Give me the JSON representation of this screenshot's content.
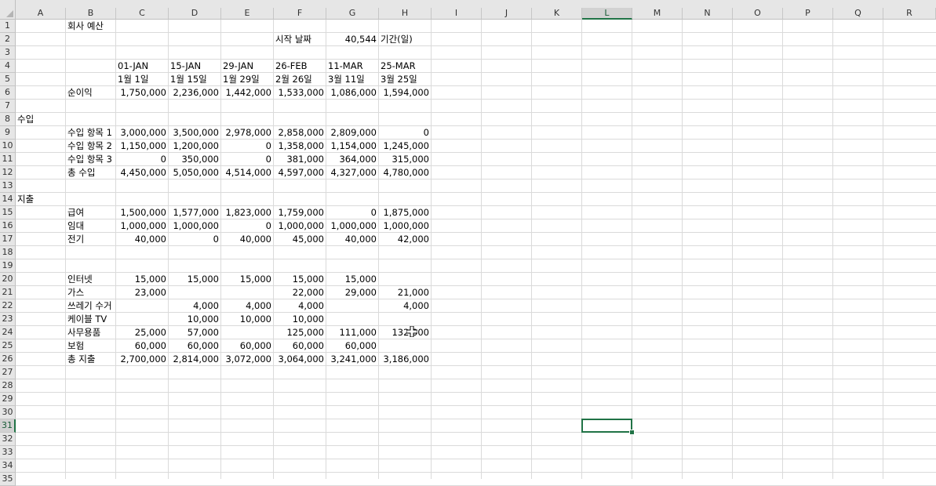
{
  "columns": [
    "A",
    "B",
    "C",
    "D",
    "E",
    "F",
    "G",
    "H",
    "I",
    "J",
    "K",
    "L",
    "M",
    "N",
    "O",
    "P",
    "Q",
    "R"
  ],
  "rows": [
    "1",
    "2",
    "3",
    "4",
    "5",
    "6",
    "7",
    "8",
    "9",
    "10",
    "11",
    "12",
    "13",
    "14",
    "15",
    "16",
    "17",
    "18",
    "19",
    "20",
    "21",
    "22",
    "23",
    "24",
    "25",
    "26",
    "27",
    "28",
    "29",
    "30",
    "31",
    "32",
    "33",
    "34",
    "35"
  ],
  "selected_column": "L",
  "selected_row": "31",
  "cells": [
    {
      "col": "B",
      "row": "1",
      "text": "회사 예산",
      "align": "l"
    },
    {
      "col": "F",
      "row": "2",
      "text": "시작 날짜",
      "align": "l"
    },
    {
      "col": "G",
      "row": "2",
      "text": "40,544",
      "align": "r"
    },
    {
      "col": "H",
      "row": "2",
      "text": "기간(일)",
      "align": "l"
    },
    {
      "col": "C",
      "row": "4",
      "text": "01-JAN",
      "align": "l"
    },
    {
      "col": "D",
      "row": "4",
      "text": "15-JAN",
      "align": "l"
    },
    {
      "col": "E",
      "row": "4",
      "text": "29-JAN",
      "align": "l"
    },
    {
      "col": "F",
      "row": "4",
      "text": "26-FEB",
      "align": "l"
    },
    {
      "col": "G",
      "row": "4",
      "text": "11-MAR",
      "align": "l"
    },
    {
      "col": "H",
      "row": "4",
      "text": "25-MAR",
      "align": "l"
    },
    {
      "col": "C",
      "row": "5",
      "text": "1월 1일",
      "align": "l"
    },
    {
      "col": "D",
      "row": "5",
      "text": "1월 15일",
      "align": "l"
    },
    {
      "col": "E",
      "row": "5",
      "text": "1월 29일",
      "align": "l"
    },
    {
      "col": "F",
      "row": "5",
      "text": "2월 26일",
      "align": "l"
    },
    {
      "col": "G",
      "row": "5",
      "text": "3월 11일",
      "align": "l"
    },
    {
      "col": "H",
      "row": "5",
      "text": "3월 25일",
      "align": "l"
    },
    {
      "col": "B",
      "row": "6",
      "text": "순이익",
      "align": "l"
    },
    {
      "col": "C",
      "row": "6",
      "text": "1,750,000",
      "align": "r"
    },
    {
      "col": "D",
      "row": "6",
      "text": "2,236,000",
      "align": "r"
    },
    {
      "col": "E",
      "row": "6",
      "text": "1,442,000",
      "align": "r"
    },
    {
      "col": "F",
      "row": "6",
      "text": "1,533,000",
      "align": "r"
    },
    {
      "col": "G",
      "row": "6",
      "text": "1,086,000",
      "align": "r"
    },
    {
      "col": "H",
      "row": "6",
      "text": "1,594,000",
      "align": "r"
    },
    {
      "col": "A",
      "row": "8",
      "text": "수입",
      "align": "l"
    },
    {
      "col": "B",
      "row": "9",
      "text": "수입 항목 1",
      "align": "l",
      "clip": true
    },
    {
      "col": "C",
      "row": "9",
      "text": "3,000,000",
      "align": "r"
    },
    {
      "col": "D",
      "row": "9",
      "text": "3,500,000",
      "align": "r"
    },
    {
      "col": "E",
      "row": "9",
      "text": "2,978,000",
      "align": "r"
    },
    {
      "col": "F",
      "row": "9",
      "text": "2,858,000",
      "align": "r"
    },
    {
      "col": "G",
      "row": "9",
      "text": "2,809,000",
      "align": "r"
    },
    {
      "col": "H",
      "row": "9",
      "text": "0",
      "align": "r"
    },
    {
      "col": "B",
      "row": "10",
      "text": "수입 항목 2",
      "align": "l",
      "clip": true
    },
    {
      "col": "C",
      "row": "10",
      "text": "1,150,000",
      "align": "r"
    },
    {
      "col": "D",
      "row": "10",
      "text": "1,200,000",
      "align": "r"
    },
    {
      "col": "E",
      "row": "10",
      "text": "0",
      "align": "r"
    },
    {
      "col": "F",
      "row": "10",
      "text": "1,358,000",
      "align": "r"
    },
    {
      "col": "G",
      "row": "10",
      "text": "1,154,000",
      "align": "r"
    },
    {
      "col": "H",
      "row": "10",
      "text": "1,245,000",
      "align": "r"
    },
    {
      "col": "B",
      "row": "11",
      "text": "수입 항목 3",
      "align": "l",
      "clip": true
    },
    {
      "col": "C",
      "row": "11",
      "text": "0",
      "align": "r"
    },
    {
      "col": "D",
      "row": "11",
      "text": "350,000",
      "align": "r"
    },
    {
      "col": "E",
      "row": "11",
      "text": "0",
      "align": "r"
    },
    {
      "col": "F",
      "row": "11",
      "text": "381,000",
      "align": "r"
    },
    {
      "col": "G",
      "row": "11",
      "text": "364,000",
      "align": "r"
    },
    {
      "col": "H",
      "row": "11",
      "text": "315,000",
      "align": "r"
    },
    {
      "col": "B",
      "row": "12",
      "text": "총 수입",
      "align": "l"
    },
    {
      "col": "C",
      "row": "12",
      "text": "4,450,000",
      "align": "r"
    },
    {
      "col": "D",
      "row": "12",
      "text": "5,050,000",
      "align": "r"
    },
    {
      "col": "E",
      "row": "12",
      "text": "4,514,000",
      "align": "r"
    },
    {
      "col": "F",
      "row": "12",
      "text": "4,597,000",
      "align": "r"
    },
    {
      "col": "G",
      "row": "12",
      "text": "4,327,000",
      "align": "r"
    },
    {
      "col": "H",
      "row": "12",
      "text": "4,780,000",
      "align": "r"
    },
    {
      "col": "A",
      "row": "14",
      "text": "지출",
      "align": "l"
    },
    {
      "col": "B",
      "row": "15",
      "text": "급여",
      "align": "l"
    },
    {
      "col": "C",
      "row": "15",
      "text": "1,500,000",
      "align": "r"
    },
    {
      "col": "D",
      "row": "15",
      "text": "1,577,000",
      "align": "r"
    },
    {
      "col": "E",
      "row": "15",
      "text": "1,823,000",
      "align": "r"
    },
    {
      "col": "F",
      "row": "15",
      "text": "1,759,000",
      "align": "r"
    },
    {
      "col": "G",
      "row": "15",
      "text": "0",
      "align": "r"
    },
    {
      "col": "H",
      "row": "15",
      "text": "1,875,000",
      "align": "r"
    },
    {
      "col": "B",
      "row": "16",
      "text": "임대",
      "align": "l"
    },
    {
      "col": "C",
      "row": "16",
      "text": "1,000,000",
      "align": "r"
    },
    {
      "col": "D",
      "row": "16",
      "text": "1,000,000",
      "align": "r"
    },
    {
      "col": "E",
      "row": "16",
      "text": "0",
      "align": "r"
    },
    {
      "col": "F",
      "row": "16",
      "text": "1,000,000",
      "align": "r"
    },
    {
      "col": "G",
      "row": "16",
      "text": "1,000,000",
      "align": "r"
    },
    {
      "col": "H",
      "row": "16",
      "text": "1,000,000",
      "align": "r"
    },
    {
      "col": "B",
      "row": "17",
      "text": "전기",
      "align": "l"
    },
    {
      "col": "C",
      "row": "17",
      "text": "40,000",
      "align": "r"
    },
    {
      "col": "D",
      "row": "17",
      "text": "0",
      "align": "r"
    },
    {
      "col": "E",
      "row": "17",
      "text": "40,000",
      "align": "r"
    },
    {
      "col": "F",
      "row": "17",
      "text": "45,000",
      "align": "r"
    },
    {
      "col": "G",
      "row": "17",
      "text": "40,000",
      "align": "r"
    },
    {
      "col": "H",
      "row": "17",
      "text": "42,000",
      "align": "r"
    },
    {
      "col": "B",
      "row": "20",
      "text": "인터넷",
      "align": "l"
    },
    {
      "col": "C",
      "row": "20",
      "text": "15,000",
      "align": "r"
    },
    {
      "col": "D",
      "row": "20",
      "text": "15,000",
      "align": "r"
    },
    {
      "col": "E",
      "row": "20",
      "text": "15,000",
      "align": "r"
    },
    {
      "col": "F",
      "row": "20",
      "text": "15,000",
      "align": "r"
    },
    {
      "col": "G",
      "row": "20",
      "text": "15,000",
      "align": "r"
    },
    {
      "col": "B",
      "row": "21",
      "text": "가스",
      "align": "l"
    },
    {
      "col": "C",
      "row": "21",
      "text": "23,000",
      "align": "r"
    },
    {
      "col": "F",
      "row": "21",
      "text": "22,000",
      "align": "r"
    },
    {
      "col": "G",
      "row": "21",
      "text": "29,000",
      "align": "r"
    },
    {
      "col": "H",
      "row": "21",
      "text": "21,000",
      "align": "r"
    },
    {
      "col": "B",
      "row": "22",
      "text": "쓰레기 수거",
      "align": "l",
      "clip": true
    },
    {
      "col": "D",
      "row": "22",
      "text": "4,000",
      "align": "r"
    },
    {
      "col": "E",
      "row": "22",
      "text": "4,000",
      "align": "r"
    },
    {
      "col": "F",
      "row": "22",
      "text": "4,000",
      "align": "r"
    },
    {
      "col": "H",
      "row": "22",
      "text": "4,000",
      "align": "r"
    },
    {
      "col": "B",
      "row": "23",
      "text": "케이블 TV",
      "align": "l"
    },
    {
      "col": "D",
      "row": "23",
      "text": "10,000",
      "align": "r"
    },
    {
      "col": "E",
      "row": "23",
      "text": "10,000",
      "align": "r"
    },
    {
      "col": "F",
      "row": "23",
      "text": "10,000",
      "align": "r"
    },
    {
      "col": "B",
      "row": "24",
      "text": "사무용품",
      "align": "l"
    },
    {
      "col": "C",
      "row": "24",
      "text": "25,000",
      "align": "r"
    },
    {
      "col": "D",
      "row": "24",
      "text": "57,000",
      "align": "r"
    },
    {
      "col": "F",
      "row": "24",
      "text": "125,000",
      "align": "r"
    },
    {
      "col": "G",
      "row": "24",
      "text": "111,000",
      "align": "r"
    },
    {
      "col": "H",
      "row": "24",
      "text": "132,000",
      "align": "r"
    },
    {
      "col": "B",
      "row": "25",
      "text": "보험",
      "align": "l"
    },
    {
      "col": "C",
      "row": "25",
      "text": "60,000",
      "align": "r"
    },
    {
      "col": "D",
      "row": "25",
      "text": "60,000",
      "align": "r"
    },
    {
      "col": "E",
      "row": "25",
      "text": "60,000",
      "align": "r"
    },
    {
      "col": "F",
      "row": "25",
      "text": "60,000",
      "align": "r"
    },
    {
      "col": "G",
      "row": "25",
      "text": "60,000",
      "align": "r"
    },
    {
      "col": "B",
      "row": "26",
      "text": "총 지출",
      "align": "l"
    },
    {
      "col": "C",
      "row": "26",
      "text": "2,700,000",
      "align": "r"
    },
    {
      "col": "D",
      "row": "26",
      "text": "2,814,000",
      "align": "r"
    },
    {
      "col": "E",
      "row": "26",
      "text": "3,072,000",
      "align": "r"
    },
    {
      "col": "F",
      "row": "26",
      "text": "3,064,000",
      "align": "r"
    },
    {
      "col": "G",
      "row": "26",
      "text": "3,241,000",
      "align": "r"
    },
    {
      "col": "H",
      "row": "26",
      "text": "3,186,000",
      "align": "r"
    }
  ],
  "icons": {
    "cursor": "cell-select-cross-cursor-icon",
    "corner": "select-all-triangle-icon"
  },
  "colors": {
    "accent": "#217346",
    "header_bg": "#e6e6e6",
    "grid": "#dadada"
  }
}
